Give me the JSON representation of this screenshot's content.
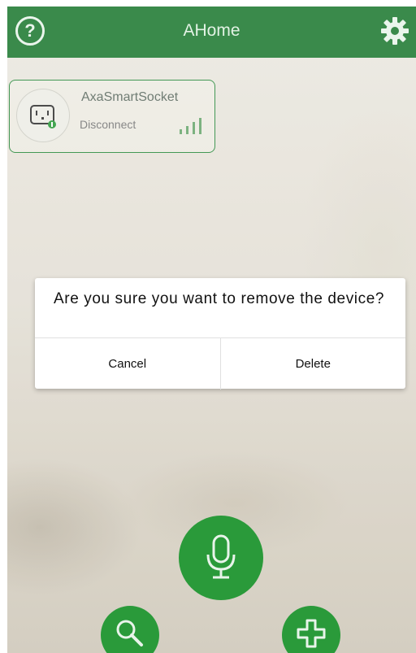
{
  "header": {
    "title": "AHome",
    "help_symbol": "?",
    "accent": "#1f7a33"
  },
  "device": {
    "name": "AxaSmartSocket",
    "status": "Disconnect",
    "icon": "smart-socket-icon"
  },
  "dialog": {
    "message": "Are you sure you want to remove the device?",
    "cancel_label": "Cancel",
    "delete_label": "Delete"
  },
  "actions": {
    "mic_icon": "microphone-icon",
    "search_icon": "search-icon",
    "add_icon": "plus-icon",
    "color": "#2a9a3a"
  }
}
